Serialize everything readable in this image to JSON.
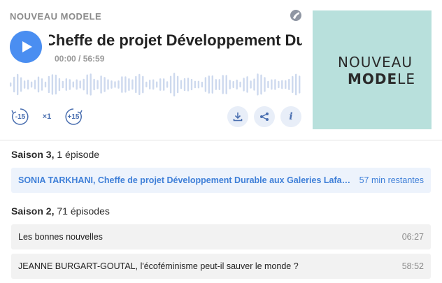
{
  "player": {
    "show_name": "NOUVEAU MODELE",
    "episode_title": "Cheffe de projet Développement Durable aux Galeries Lafayette",
    "time_display": "00:00 / 56:59",
    "skip_back_label": "-15",
    "speed_label": "×1",
    "skip_forward_label": "+15",
    "info_label": "i"
  },
  "cover": {
    "line1": "NOUVEAU",
    "line2_bold": "MODE",
    "line2_thin": "LE"
  },
  "seasons": [
    {
      "name": "Saison 3,",
      "count": " 1 épisode",
      "episodes": [
        {
          "title": "SONIA TARKHANI, Cheffe de projet Développement Durable aux Galeries Lafayette",
          "duration": "57 min restantes",
          "active": true
        }
      ]
    },
    {
      "name": "Saison 2,",
      "count": " 71 épisodes",
      "episodes": [
        {
          "title": "Les bonnes nouvelles",
          "duration": "06:27",
          "active": false
        },
        {
          "title": "JEANNE BURGART-GOUTAL, l'écoféminisme peut-il sauver le monde ?",
          "duration": "58:52",
          "active": false
        }
      ]
    }
  ],
  "colors": {
    "accent": "#4a8ef1",
    "cover_bg": "#b8e0dc",
    "waveform": "#cdd9ee"
  },
  "icons": [
    "play-icon",
    "brand-icon",
    "rewind-15-icon",
    "forward-15-icon",
    "download-icon",
    "share-icon",
    "info-icon"
  ]
}
